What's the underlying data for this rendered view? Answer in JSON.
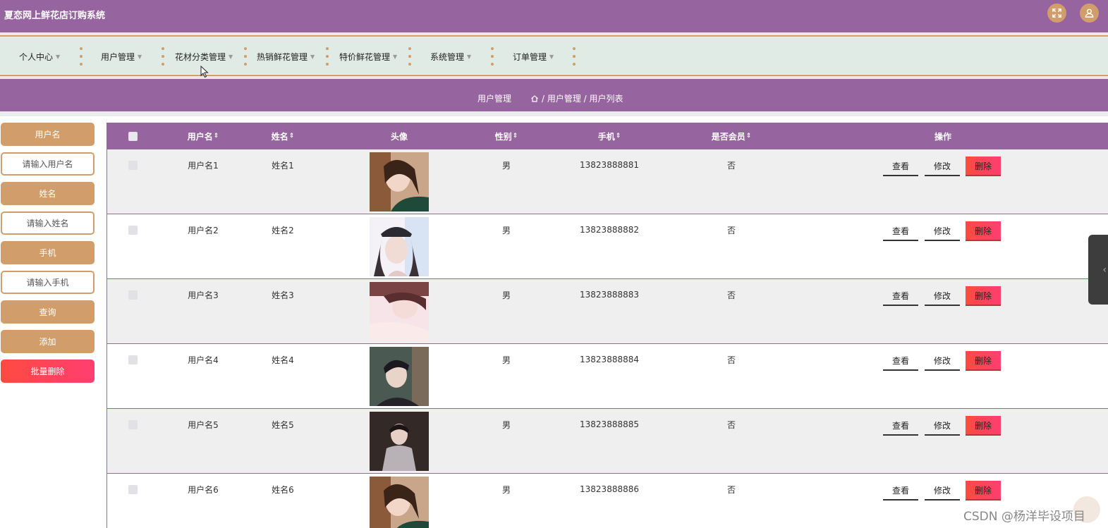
{
  "app": {
    "title": "夏恋网上鲜花店订购系统"
  },
  "nav": {
    "items": [
      {
        "label": "个人中心"
      },
      {
        "label": "用户管理"
      },
      {
        "label": "花材分类管理"
      },
      {
        "label": "热销鲜花管理"
      },
      {
        "label": "特价鲜花管理"
      },
      {
        "label": "系统管理"
      },
      {
        "label": "订单管理"
      }
    ]
  },
  "breadcrumb": {
    "title": "用户管理",
    "path": "/ 用户管理 / 用户列表"
  },
  "search": {
    "username_label": "用户名",
    "username_placeholder": "请输入用户名",
    "name_label": "姓名",
    "name_placeholder": "请输入姓名",
    "phone_label": "手机",
    "phone_placeholder": "请输入手机",
    "query_btn": "查询",
    "add_btn": "添加",
    "batch_delete_btn": "批量删除"
  },
  "table": {
    "headers": {
      "username": "用户名",
      "name": "姓名",
      "avatar": "头像",
      "gender": "性别",
      "phone": "手机",
      "member": "是否会员",
      "actions": "操作"
    },
    "sort_icon": "⇕",
    "rows": [
      {
        "username": "用户名1",
        "name": "姓名1",
        "gender": "男",
        "phone": "13823888881",
        "member": "否",
        "view": "查看",
        "edit": "修改",
        "delete": "删除"
      },
      {
        "username": "用户名2",
        "name": "姓名2",
        "gender": "男",
        "phone": "13823888882",
        "member": "否",
        "view": "查看",
        "edit": "修改",
        "delete": "删除"
      },
      {
        "username": "用户名3",
        "name": "姓名3",
        "gender": "男",
        "phone": "13823888883",
        "member": "否",
        "view": "查看",
        "edit": "修改",
        "delete": "删除"
      },
      {
        "username": "用户名4",
        "name": "姓名4",
        "gender": "男",
        "phone": "13823888884",
        "member": "否",
        "view": "查看",
        "edit": "修改",
        "delete": "删除"
      },
      {
        "username": "用户名5",
        "name": "姓名5",
        "gender": "男",
        "phone": "13823888885",
        "member": "否",
        "view": "查看",
        "edit": "修改",
        "delete": "删除"
      },
      {
        "username": "用户名6",
        "name": "姓名6",
        "gender": "男",
        "phone": "13823888886",
        "member": "否",
        "view": "查看",
        "edit": "修改",
        "delete": "删除"
      }
    ]
  },
  "watermark": "CSDN @杨洋毕设项目",
  "colors": {
    "primary": "#96649e",
    "accent": "#d09d6b",
    "nav_bg": "#e1ebe6",
    "danger": "#ff4a40"
  },
  "icons": {
    "fullscreen": "fullscreen-icon",
    "user": "user-icon",
    "home": "home-icon",
    "collapse": "chevron-left-icon"
  }
}
